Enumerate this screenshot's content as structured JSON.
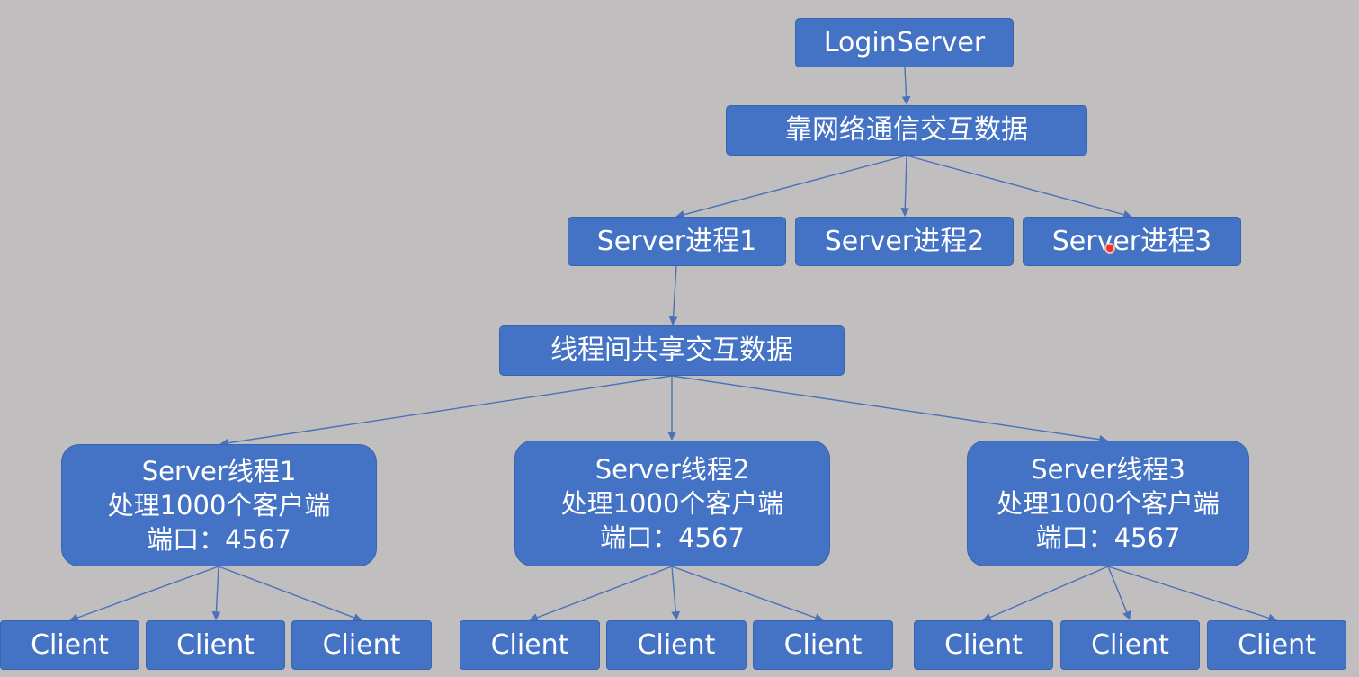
{
  "diagram": {
    "login_server": "LoginServer",
    "network_exchange": "靠网络通信交互数据",
    "processes": [
      "Server进程1",
      "Server进程2",
      "Server进程3"
    ],
    "thread_exchange": "线程间共享交互数据",
    "threads": [
      {
        "name": "Server线程1",
        "desc": "处理1000个客户端",
        "port": "端口：4567"
      },
      {
        "name": "Server线程2",
        "desc": "处理1000个客户端",
        "port": "端口：4567"
      },
      {
        "name": "Server线程3",
        "desc": "处理1000个客户端",
        "port": "端口：4567"
      }
    ],
    "client_label": "Client"
  },
  "colors": {
    "background": "#c0bebf",
    "node_fill": "#4472c4",
    "node_border": "#3a63ad",
    "text": "#ffffff",
    "edge": "#4a72b8"
  }
}
